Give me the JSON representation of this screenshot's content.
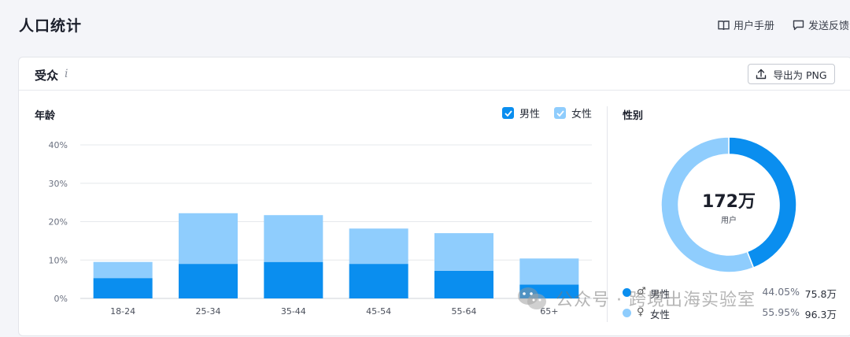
{
  "page": {
    "title": "人口统计"
  },
  "top_actions": {
    "manual": "用户手册",
    "feedback": "发送反馈"
  },
  "card": {
    "title": "受众",
    "info_icon": "i",
    "export_label": "导出为 PNG"
  },
  "age_section": {
    "title": "年龄"
  },
  "gender_section": {
    "title": "性别"
  },
  "colors": {
    "male": "#0a8eef",
    "female": "#8fcdfd",
    "grid": "#e6e8ec"
  },
  "chart_data": [
    {
      "type": "bar",
      "title": "年龄",
      "stacked": true,
      "categories": [
        "18-24",
        "25-34",
        "35-44",
        "45-54",
        "55-64",
        "65+"
      ],
      "series": [
        {
          "name": "男性",
          "values": [
            5.3,
            9.0,
            9.5,
            9.0,
            7.2,
            3.6
          ]
        },
        {
          "name": "女性",
          "values": [
            4.2,
            13.2,
            12.2,
            9.2,
            9.8,
            6.8
          ]
        }
      ],
      "y_ticks": [
        "0%",
        "10%",
        "20%",
        "30%",
        "40%"
      ],
      "ylim": [
        0,
        40
      ],
      "grid": true,
      "legend_position": "top-right"
    },
    {
      "type": "pie",
      "title": "性别",
      "donut": true,
      "center_value": "172万",
      "center_label": "用户",
      "slices": [
        {
          "name": "男性",
          "symbol": "♂",
          "value": 44.05,
          "percent_label": "44.05%",
          "count_label": "75.8万"
        },
        {
          "name": "女性",
          "symbol": "♀",
          "value": 55.95,
          "percent_label": "55.95%",
          "count_label": "96.3万"
        }
      ]
    }
  ],
  "watermark": {
    "text": "公众号 · 跨境出海实验室"
  }
}
